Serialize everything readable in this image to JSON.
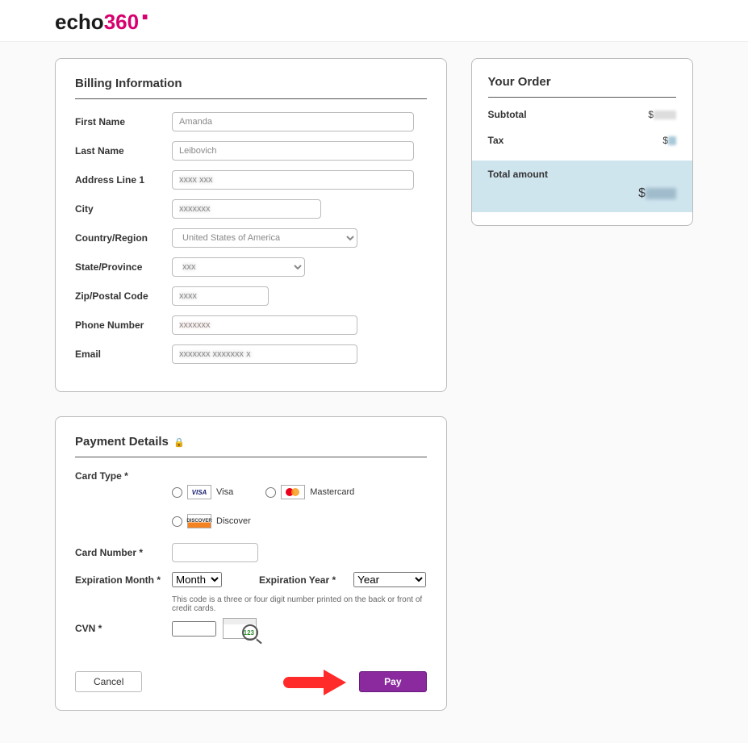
{
  "brand": {
    "part1": "echo",
    "part2": "360"
  },
  "billing": {
    "heading": "Billing Information",
    "labels": {
      "first_name": "First Name",
      "last_name": "Last Name",
      "address1": "Address Line 1",
      "city": "City",
      "country": "Country/Region",
      "state": "State/Province",
      "zip": "Zip/Postal Code",
      "phone": "Phone Number",
      "email": "Email"
    },
    "values": {
      "first_name": "Amanda",
      "last_name": "Leibovich",
      "address1": "",
      "city": "",
      "country": "United States of America",
      "state": "",
      "zip": "",
      "phone": "",
      "email": ""
    }
  },
  "payment": {
    "heading": "Payment Details",
    "card_type_label": "Card Type *",
    "card_options": {
      "visa": "Visa",
      "mastercard": "Mastercard",
      "discover": "Discover"
    },
    "card_number_label": "Card Number *",
    "exp_month_label": "Expiration Month *",
    "exp_year_label": "Expiration Year *",
    "exp_month_value": "Month",
    "exp_year_value": "Year",
    "cvn_label": "CVN *",
    "cvn_hint": "This code is a three or four digit number printed on the back or front of credit cards.",
    "cancel": "Cancel",
    "pay": "Pay"
  },
  "order": {
    "heading": "Your Order",
    "subtotal_label": "Subtotal",
    "tax_label": "Tax",
    "total_label": "Total amount",
    "currency": "$"
  }
}
